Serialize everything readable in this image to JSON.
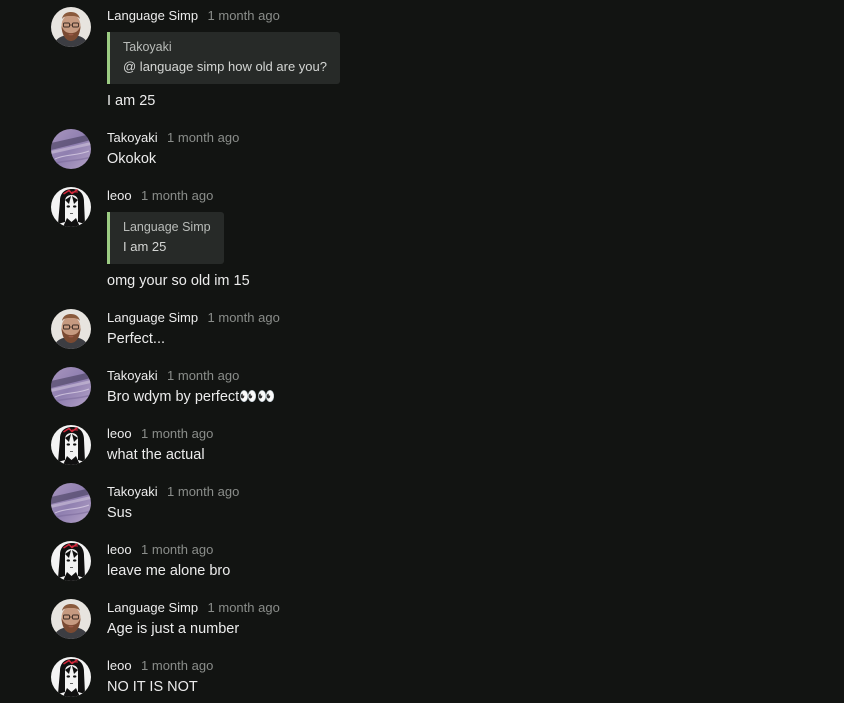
{
  "colors": {
    "background": "#121412",
    "quote_background": "#272a28",
    "quote_border": "#9ccc83",
    "timestamp": "#8a8d8a"
  },
  "comments": [
    {
      "author": "Language Simp",
      "time": "1 month ago",
      "avatar": "bearded-man-avatar",
      "quote": {
        "author": "Takoyaki",
        "text": "@ language simp how old are you?"
      },
      "text": "I am 25"
    },
    {
      "author": "Takoyaki",
      "time": "1 month ago",
      "avatar": "blurred-purple-avatar",
      "text": "Okokok"
    },
    {
      "author": "leoo",
      "time": "1 month ago",
      "avatar": "manga-character-avatar",
      "quote": {
        "author": "Language Simp",
        "text": "I am 25"
      },
      "text": "omg your so old im 15"
    },
    {
      "author": "Language Simp",
      "time": "1 month ago",
      "avatar": "bearded-man-avatar",
      "text": "Perfect..."
    },
    {
      "author": "Takoyaki",
      "time": "1 month ago",
      "avatar": "blurred-purple-avatar",
      "text": "Bro wdym by perfect👀👀"
    },
    {
      "author": "leoo",
      "time": "1 month ago",
      "avatar": "manga-character-avatar",
      "text": "what the actual"
    },
    {
      "author": "Takoyaki",
      "time": "1 month ago",
      "avatar": "blurred-purple-avatar",
      "text": "Sus"
    },
    {
      "author": "leoo",
      "time": "1 month ago",
      "avatar": "manga-character-avatar",
      "text": "leave me alone bro"
    },
    {
      "author": "Language Simp",
      "time": "1 month ago",
      "avatar": "bearded-man-avatar",
      "text": "Age is just a number"
    },
    {
      "author": "leoo",
      "time": "1 month ago",
      "avatar": "manga-character-avatar",
      "text": "NO IT IS NOT"
    }
  ]
}
